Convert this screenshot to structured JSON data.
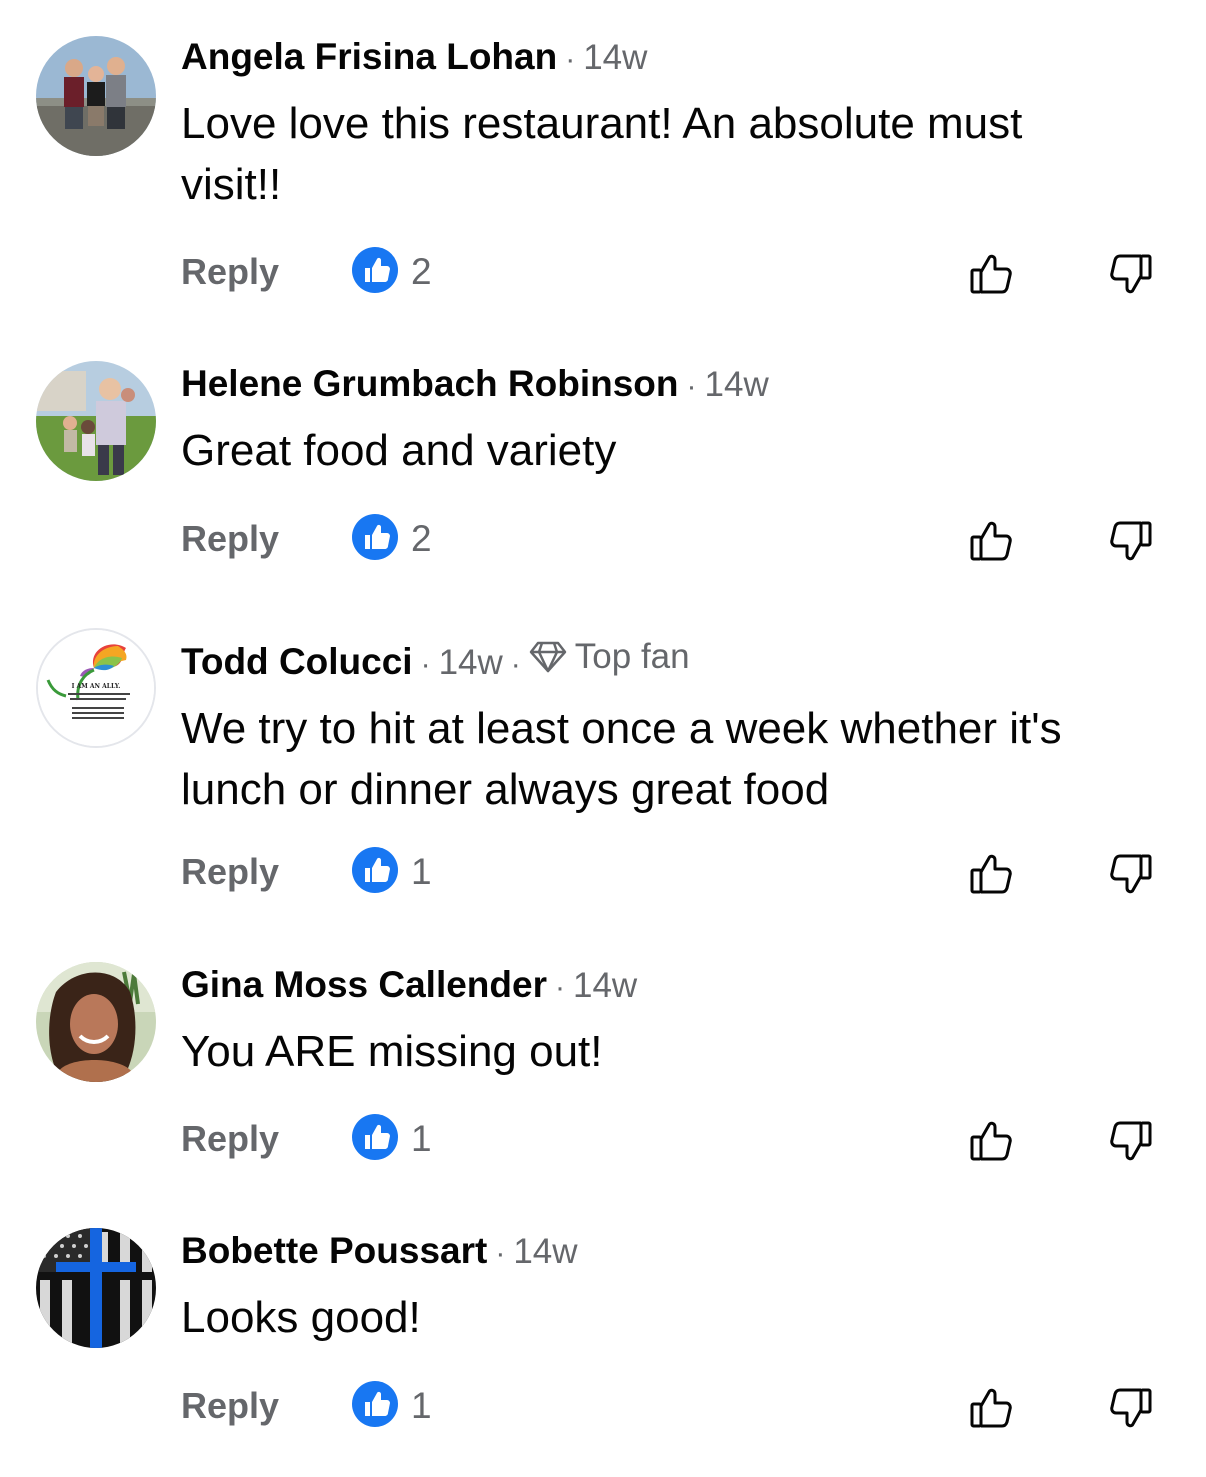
{
  "comments": [
    {
      "author": "Angela Frisina Lohan",
      "time": "14w",
      "text": "Love love this restaurant!  An absolute must visit!!",
      "reply_label": "Reply",
      "like_count": "2"
    },
    {
      "author": "Helene Grumbach Robinson",
      "time": "14w",
      "text": "Great food and variety",
      "reply_label": "Reply",
      "like_count": "2"
    },
    {
      "author": "Todd Colucci",
      "time": "14w",
      "badge": "Top fan",
      "text": "We try to hit at least once a week whether it's lunch or dinner always great food",
      "reply_label": "Reply",
      "like_count": "1"
    },
    {
      "author": "Gina Moss Callender",
      "time": "14w",
      "text": "You ARE missing out!",
      "reply_label": "Reply",
      "like_count": "1"
    },
    {
      "author": "Bobette Poussart",
      "time": "14w",
      "text": "Looks good!",
      "reply_label": "Reply",
      "like_count": "1"
    }
  ],
  "separator": "·",
  "avatar_logo_text": "I AM AN ALLY.",
  "colors": {
    "like_blue": "#1877f2",
    "meta_gray": "#65676b",
    "text": "#050505"
  },
  "icons": {
    "like_badge": "like-badge-icon",
    "thumbs_up": "thumbs-up-icon",
    "thumbs_down": "thumbs-down-icon",
    "top_fan": "diamond-icon"
  }
}
